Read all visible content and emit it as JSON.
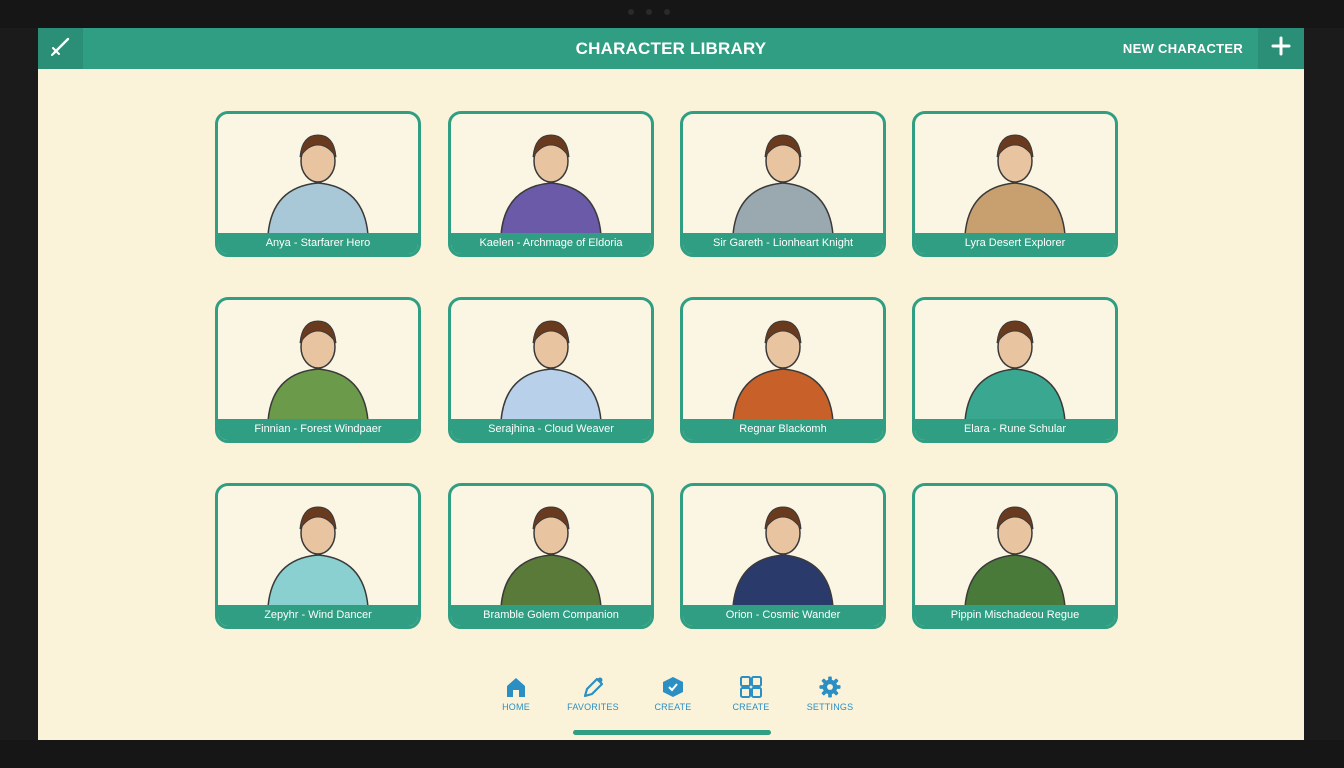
{
  "header": {
    "title": "CHARACTER LIBRARY",
    "new_character_label": "NEW CHARACTER",
    "menu_icon": "sword-icon",
    "add_icon": "plus-icon"
  },
  "characters": [
    {
      "name": "Anya - Starfarer Hero",
      "theme": "#a8c8d8"
    },
    {
      "name": "Kaelen - Archmage of Eldoria",
      "theme": "#6a5aa8"
    },
    {
      "name": "Sir Gareth - Lionheart Knight",
      "theme": "#9aa8b0"
    },
    {
      "name": "Lyra Desert Explorer",
      "theme": "#c8a070"
    },
    {
      "name": "Finnian - Forest Windpaer",
      "theme": "#6a9a4a"
    },
    {
      "name": "Serajhina - Cloud Weaver",
      "theme": "#b8d0ea"
    },
    {
      "name": "Regnar Blackomh",
      "theme": "#c8602a"
    },
    {
      "name": "Elara - Rune Schular",
      "theme": "#3aa890"
    },
    {
      "name": "Zepyhr - Wind Dancer",
      "theme": "#8ad0d0"
    },
    {
      "name": "Bramble Golem Companion",
      "theme": "#5a7a3a"
    },
    {
      "name": "Orion - Cosmic Wander",
      "theme": "#2a3a6a"
    },
    {
      "name": "Pippin Mischadeou Regue",
      "theme": "#4a7a3a"
    }
  ],
  "bottom_nav": [
    {
      "label": "HOME",
      "icon": "home-icon"
    },
    {
      "label": "FAVORITES",
      "icon": "favorites-icon"
    },
    {
      "label": "CREATE",
      "icon": "create-icon"
    },
    {
      "label": "CREATE",
      "icon": "grid-icon"
    },
    {
      "label": "SETTINGS",
      "icon": "gear-icon"
    }
  ],
  "colors": {
    "accent": "#2f9e82",
    "background": "#fbf3d9",
    "nav_icon": "#2b8fc4"
  }
}
